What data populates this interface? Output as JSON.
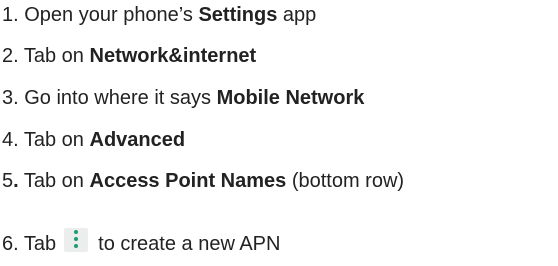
{
  "steps": [
    {
      "num": "1.",
      "before": " Open your phone’s ",
      "bold": "Settings",
      "after": " app"
    },
    {
      "num": "2.",
      "before": " Tab on ",
      "bold": "Network&internet",
      "after": ""
    },
    {
      "num": "3.",
      "before": " Go into where it says ",
      "bold": "Mobile Network",
      "after": ""
    },
    {
      "num": "4.",
      "before": " Tab on ",
      "bold": "Advanced",
      "after": ""
    },
    {
      "num": "5",
      "num_suffix": ".",
      "before": " Tab on ",
      "bold": "Access Point Names",
      "after": " (bottom row)"
    },
    {
      "num": "6.",
      "before": " Tab",
      "after": "to create a new APN",
      "icon": "more-vertical-icon"
    }
  ],
  "colors": {
    "text": "#222222",
    "icon_dots": "#1f9d6d",
    "icon_bg": "#eceeee"
  }
}
